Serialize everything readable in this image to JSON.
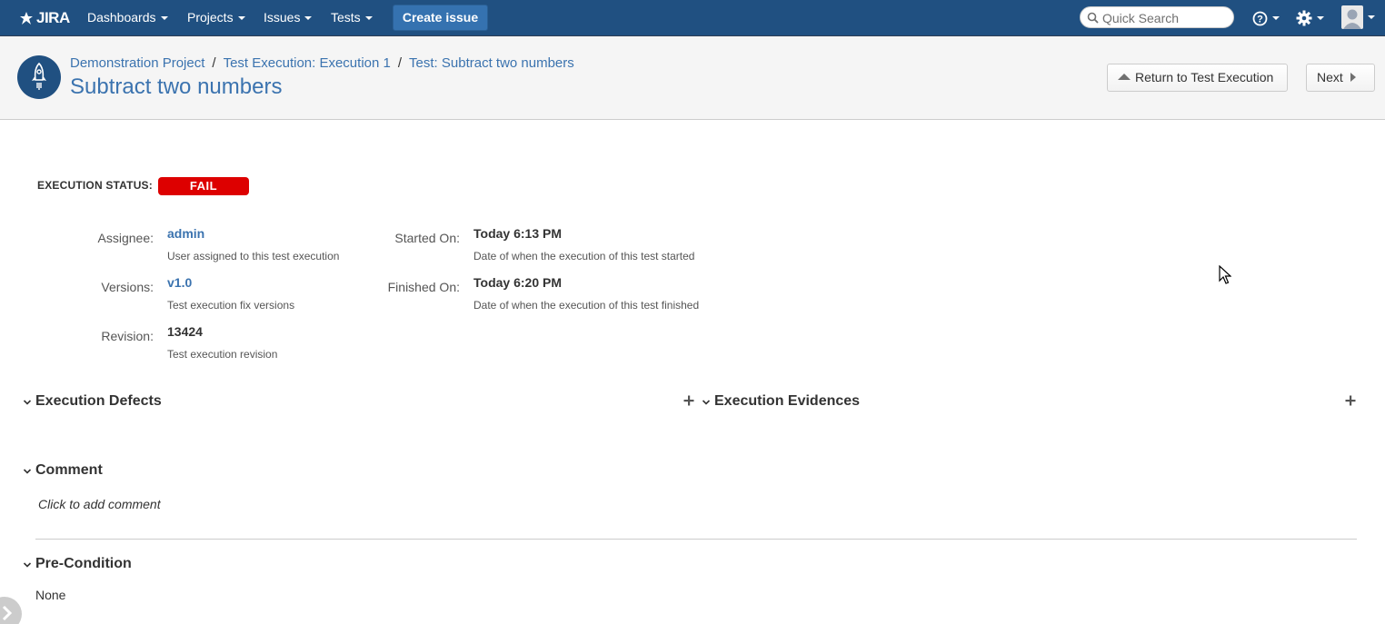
{
  "nav": {
    "logo": "JIRA",
    "items": [
      "Dashboards",
      "Projects",
      "Issues",
      "Tests"
    ],
    "create_label": "Create issue",
    "search_placeholder": "Quick Search"
  },
  "header": {
    "breadcrumbs": [
      "Demonstration Project",
      "Test Execution: Execution 1",
      "Test: Subtract two numbers"
    ],
    "title": "Subtract two numbers",
    "return_button": "Return to Test Execution",
    "next_button": "Next"
  },
  "status": {
    "label": "EXECUTION STATUS:",
    "value": "FAIL",
    "color": "#dd0000"
  },
  "fields": {
    "assignee": {
      "label": "Assignee:",
      "value": "admin",
      "desc": "User assigned to this test execution"
    },
    "versions": {
      "label": "Versions:",
      "value": "v1.0",
      "desc": "Test execution fix versions"
    },
    "revision": {
      "label": "Revision:",
      "value": "13424",
      "desc": "Test execution revision"
    },
    "started": {
      "label": "Started On:",
      "value": "Today 6:13 PM",
      "desc": "Date of when the execution of this test started"
    },
    "finished": {
      "label": "Finished On:",
      "value": "Today 6:20 PM",
      "desc": "Date of when the execution of this test finished"
    }
  },
  "sections": {
    "defects": "Execution Defects",
    "evidences": "Execution Evidences",
    "comment": "Comment",
    "comment_placeholder": "Click to add comment",
    "precondition": "Pre-Condition",
    "precondition_value": "None"
  },
  "colors": {
    "nav_bg": "#205081",
    "link": "#3b73af",
    "fail": "#dd0000"
  }
}
